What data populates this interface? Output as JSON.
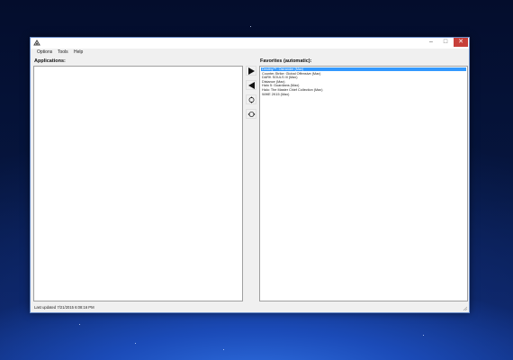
{
  "window": {
    "title_icon": "app-logo-icon",
    "controls": {
      "minimize": "–",
      "maximize": "□",
      "close": "✕"
    }
  },
  "menu": [
    "Options",
    "Tools",
    "Help"
  ],
  "left_pane": {
    "label": "Applications:",
    "items": []
  },
  "right_pane": {
    "label": "Favorites (automatic):",
    "items": [
      {
        "text": "Destiny™: Ostrander (Max)",
        "selected": true
      },
      {
        "text": "Counter-Strike: Global Offensive (Max)",
        "selected": false
      },
      {
        "text": "DARK SOULS III (Max)",
        "selected": false
      },
      {
        "text": "Distance (Max)",
        "selected": false
      },
      {
        "text": "Halo 5: Guardians (Max)",
        "selected": false
      },
      {
        "text": "Halo: The Master Chief Collection (Max)",
        "selected": false
      },
      {
        "text": "WWE 2K15 (Max)",
        "selected": false
      }
    ]
  },
  "side_buttons": [
    "add-right-arrow-icon",
    "remove-left-arrow-icon",
    "move-up-icon",
    "move-down-icon"
  ],
  "status": {
    "text": "Last updated 7/21/2015 6:08:16 PM"
  },
  "colors": {
    "selection": "#3399ff",
    "close_button": "#c7403a",
    "desktop_glow": "#2f6fe0"
  }
}
